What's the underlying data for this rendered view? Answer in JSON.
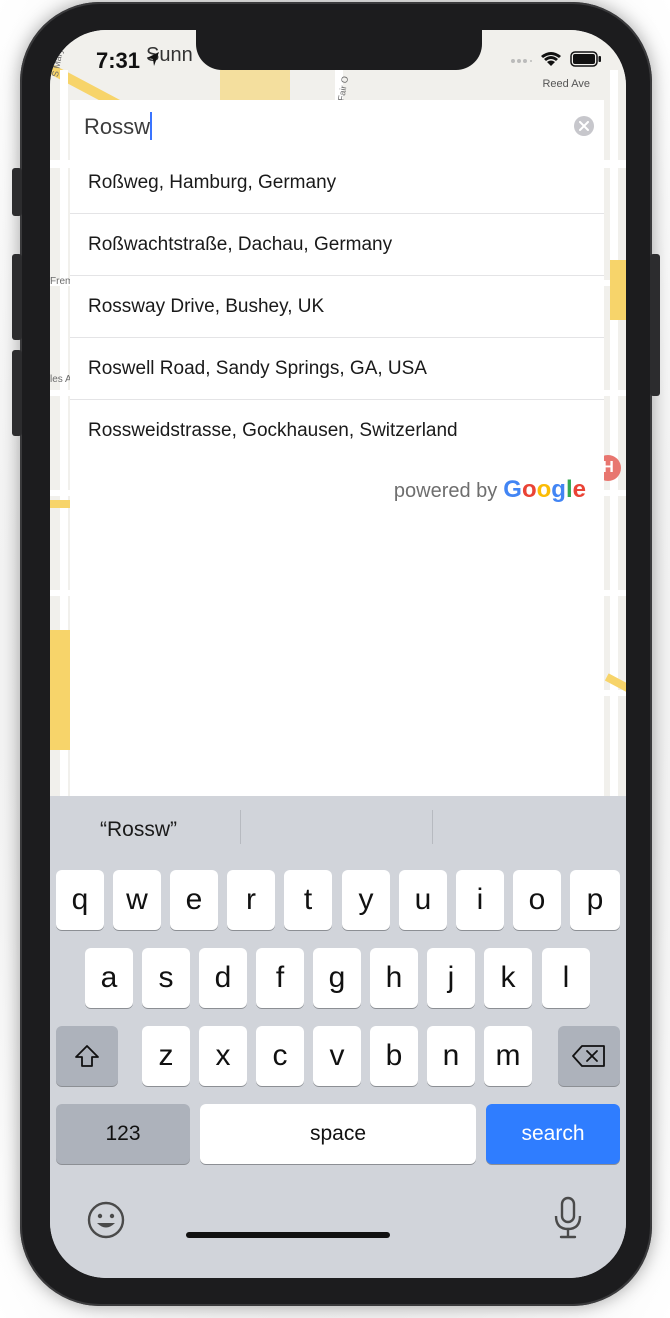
{
  "status": {
    "time": "7:31"
  },
  "map": {
    "labels": [
      "Sunn",
      "Reed Ave",
      "S Mary Ave",
      "Fair O",
      "Frem",
      "les A"
    ]
  },
  "search": {
    "value": "Rossw",
    "placeholder": ""
  },
  "results": [
    {
      "label": "Roßweg, Hamburg, Germany"
    },
    {
      "label": "Roßwachtstraße, Dachau, Germany"
    },
    {
      "label": "Rossway Drive, Bushey, UK"
    },
    {
      "label": "Roswell Road, Sandy Springs, GA, USA"
    },
    {
      "label": "Rossweidstrasse, Gockhausen, Switzerland"
    }
  ],
  "attribution": {
    "powered_by": "powered by",
    "google": [
      "G",
      "o",
      "o",
      "g",
      "l",
      "e"
    ],
    "google_colors": [
      "#4285F4",
      "#EA4335",
      "#FBBC05",
      "#4285F4",
      "#34A853",
      "#EA4335"
    ]
  },
  "keyboard": {
    "suggestion": "“Rossw”",
    "row1": [
      "q",
      "w",
      "e",
      "r",
      "t",
      "y",
      "u",
      "i",
      "o",
      "p"
    ],
    "row2": [
      "a",
      "s",
      "d",
      "f",
      "g",
      "h",
      "j",
      "k",
      "l"
    ],
    "row3": [
      "z",
      "x",
      "c",
      "v",
      "b",
      "n",
      "m"
    ],
    "numbers_label": "123",
    "space_label": "space",
    "search_label": "search",
    "accent_color": "#2f7dff"
  }
}
